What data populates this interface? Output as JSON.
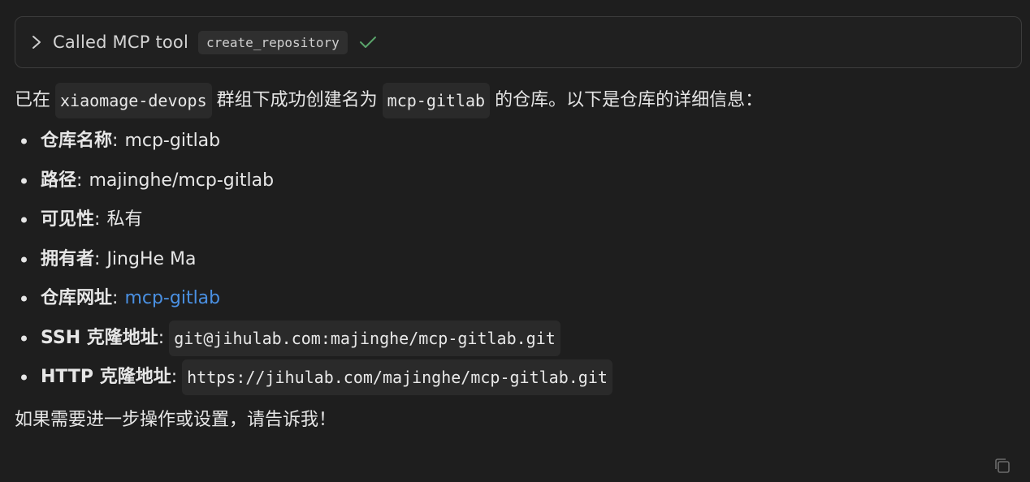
{
  "tool_call": {
    "title": "Called MCP tool",
    "tool_name": "create_repository",
    "status_icon": "check-icon",
    "accent_color": "#5aa36a"
  },
  "message": {
    "intro_prefix": "已在",
    "intro_group": "xiaomage-devops",
    "intro_middle": "群组下成功创建名为",
    "intro_repo": "mcp-gitlab",
    "intro_suffix": "的仓库。以下是仓库的详细信息：",
    "details": [
      {
        "label": "仓库名称",
        "value": "mcp-gitlab"
      },
      {
        "label": "路径",
        "value": "majinghe/mcp-gitlab"
      },
      {
        "label": "可见性",
        "value": "私有"
      },
      {
        "label": "拥有者",
        "value": "JingHe Ma"
      },
      {
        "label": "仓库网址",
        "value": "mcp-gitlab",
        "type": "link"
      },
      {
        "label": "SSH 克隆地址",
        "value": "git@jihulab.com:majinghe/mcp-gitlab.git",
        "type": "code"
      },
      {
        "label": "HTTP 克隆地址",
        "value": "https://jihulab.com/majinghe/mcp-gitlab.git",
        "type": "code"
      }
    ],
    "outro": "如果需要进一步操作或设置，请告诉我！",
    "link_color": "#4a90e2"
  },
  "actions": {
    "copy_icon": "copy-icon"
  }
}
